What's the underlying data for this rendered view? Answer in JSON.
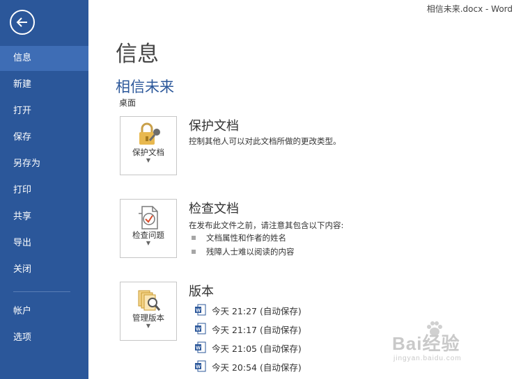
{
  "window": {
    "title": "相信未来.docx - Word"
  },
  "sidebar": {
    "items": [
      {
        "label": "信息",
        "active": true
      },
      {
        "label": "新建"
      },
      {
        "label": "打开"
      },
      {
        "label": "保存"
      },
      {
        "label": "另存为"
      },
      {
        "label": "打印"
      },
      {
        "label": "共享"
      },
      {
        "label": "导出"
      },
      {
        "label": "关闭"
      },
      {
        "label": "帐户"
      },
      {
        "label": "选项"
      }
    ]
  },
  "main": {
    "title": "信息",
    "doc_name": "相信未来",
    "doc_location": "桌面",
    "protect": {
      "tile_label": "保护文档",
      "heading": "保护文档",
      "description": "控制其他人可以对此文档所做的更改类型。"
    },
    "inspect": {
      "tile_label": "检查问题",
      "heading": "检查文档",
      "description": "在发布此文件之前，请注意其包含以下内容:",
      "bullets": [
        "文档属性和作者的姓名",
        "残障人士难以阅读的内容"
      ]
    },
    "versions": {
      "tile_label": "管理版本",
      "heading": "版本",
      "items": [
        {
          "label": "今天 21:27 (自动保存)"
        },
        {
          "label": "今天 21:17 (自动保存)"
        },
        {
          "label": "今天 21:05 (自动保存)"
        },
        {
          "label": "今天 20:54 (自动保存)"
        }
      ]
    }
  },
  "watermark": {
    "main": "Bai经验",
    "sub": "jingyan.baidu.com"
  },
  "colors": {
    "sidebar": "#2b579a",
    "sidebar_active": "#3e6db5",
    "accent": "#2b579a"
  }
}
